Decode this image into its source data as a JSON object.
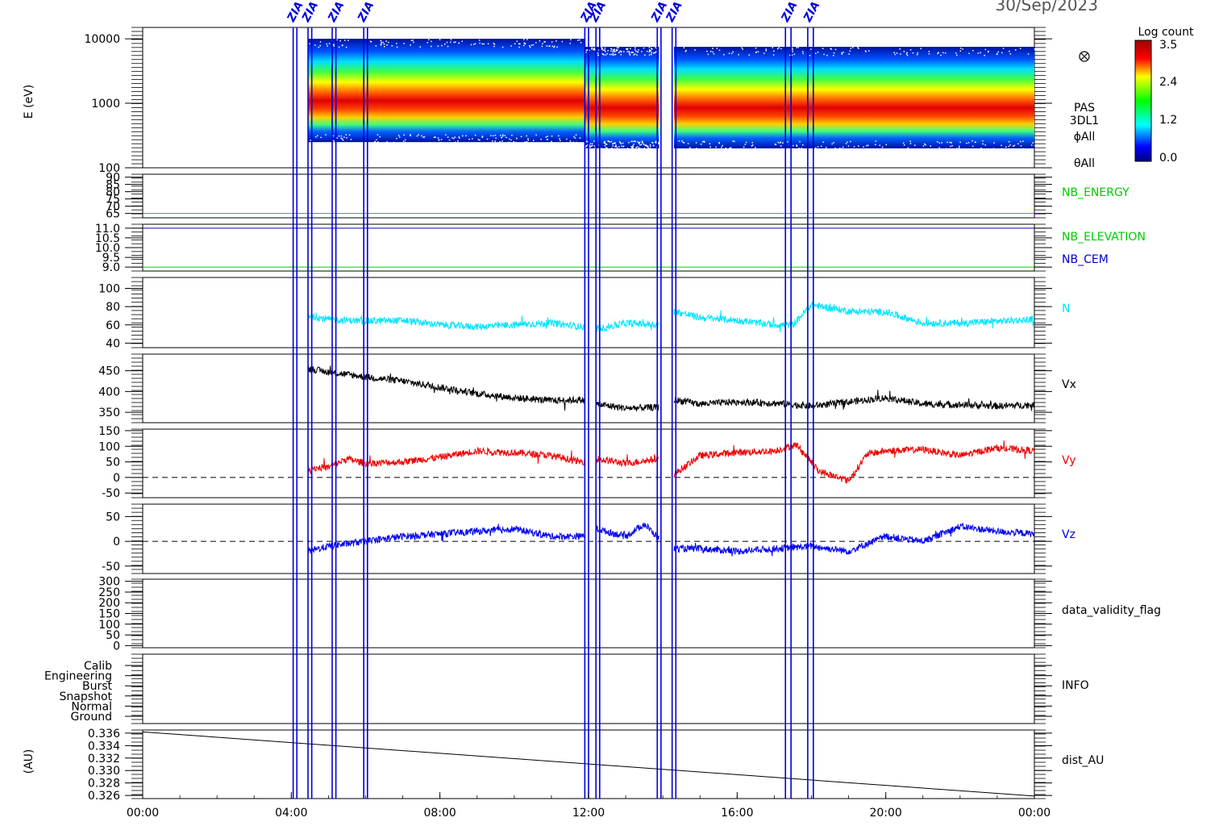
{
  "header": {
    "date": "30/Sep/2023"
  },
  "x_axis": {
    "ticks": [
      "00:00",
      "04:00",
      "08:00",
      "12:00",
      "16:00",
      "20:00",
      "00:00"
    ],
    "range_hours": [
      0,
      24
    ]
  },
  "marker_lines": {
    "color": "#0000dd",
    "hours": [
      4.05,
      4.15,
      4.45,
      4.55,
      5.1,
      5.2,
      5.95,
      6.05,
      11.9,
      12.0,
      12.2,
      12.3,
      13.85,
      13.95,
      14.25,
      14.35,
      17.3,
      17.45,
      17.9,
      18.05
    ],
    "tags": [
      {
        "hour": 4.1,
        "text": "ZIA"
      },
      {
        "hour": 4.5,
        "text": "ZIA"
      },
      {
        "hour": 5.2,
        "text": "ZIA"
      },
      {
        "hour": 6.0,
        "text": "ZIA"
      },
      {
        "hour": 12.0,
        "text": "ZIA"
      },
      {
        "hour": 12.25,
        "text": "ZIA"
      },
      {
        "hour": 13.9,
        "text": "ZIA"
      },
      {
        "hour": 14.3,
        "text": "ZIA"
      },
      {
        "hour": 17.4,
        "text": "ZIA"
      },
      {
        "hour": 18.0,
        "text": "ZIA"
      }
    ]
  },
  "colorbar": {
    "title": "Log count",
    "ticks": [
      "3.5",
      "2.4",
      "1.2",
      "0.0"
    ],
    "range": [
      0.0,
      3.5
    ]
  },
  "chart_data": [
    {
      "id": "spectrogram",
      "type": "heatmap",
      "ylabel": "E (eV)",
      "yscale": "log",
      "ylim": [
        100,
        15000
      ],
      "yticks": [
        "10000",
        "1000",
        "100"
      ],
      "right_labels": [
        "PAS",
        "3DL1",
        "ϕAll",
        "θAll"
      ],
      "data_intervals_hours": [
        [
          4.45,
          11.9,
          250,
          10000
        ],
        [
          11.9,
          13.9,
          200,
          7500
        ],
        [
          14.3,
          24,
          200,
          7500
        ]
      ],
      "peak_energy_eV": 850
    },
    {
      "id": "nb_energy",
      "type": "line",
      "label": "NB_ENERGY",
      "label_color": "#00cc00",
      "ylim": [
        62,
        92
      ],
      "yticks": [
        "90",
        "85",
        "80",
        "75",
        "70",
        "65"
      ],
      "series": [
        {
          "name": "NB_ENERGY",
          "color": "#00cc00",
          "constant": 65
        }
      ]
    },
    {
      "id": "nb_elevation",
      "type": "line",
      "labels": [
        {
          "text": "NB_ELEVATION",
          "color": "#00cc00"
        },
        {
          "text": "NB_CEM",
          "color": "#0000cc"
        }
      ],
      "ylim": [
        8.8,
        11.2
      ],
      "yticks": [
        "11.0",
        "10.5",
        "10.0",
        "9.5",
        "9.0"
      ],
      "series": [
        {
          "name": "NB_ELEVATION",
          "color": "#00cc00",
          "constant": 9.0
        },
        {
          "name": "NB_CEM",
          "color": "#0000cc",
          "constant": 11.0
        }
      ]
    },
    {
      "id": "density",
      "type": "line",
      "label": "N",
      "label_color": "#00e5ff",
      "ylim": [
        35,
        112
      ],
      "yticks": [
        "100",
        "80",
        "60",
        "40"
      ],
      "series": [
        {
          "name": "N",
          "color": "#00e5ff",
          "x": [
            4.45,
            5,
            6,
            7,
            8,
            9,
            10,
            11,
            11.8,
            12.2,
            13,
            13.9,
            14.3,
            15,
            16,
            17,
            17.5,
            18,
            19,
            20,
            21,
            22,
            23,
            24
          ],
          "y": [
            70,
            66,
            64,
            65,
            60,
            58,
            60,
            62,
            58,
            55,
            62,
            60,
            75,
            68,
            65,
            60,
            60,
            82,
            75,
            74,
            62,
            62,
            64,
            66
          ]
        }
      ]
    },
    {
      "id": "vx",
      "type": "line",
      "label": "Vx",
      "label_color": "#000000",
      "ylim": [
        325,
        490
      ],
      "yticks": [
        "450",
        "400",
        "350"
      ],
      "series": [
        {
          "name": "Vx",
          "color": "#000000",
          "x": [
            4.45,
            5,
            6,
            7,
            8,
            9,
            10,
            11,
            11.8,
            12.2,
            13,
            13.9,
            14.3,
            15,
            16,
            17,
            18,
            19,
            20,
            21,
            22,
            23,
            24
          ],
          "y": [
            455,
            447,
            435,
            425,
            410,
            395,
            385,
            378,
            380,
            370,
            360,
            362,
            380,
            370,
            375,
            372,
            365,
            375,
            385,
            370,
            368,
            365,
            368
          ]
        }
      ]
    },
    {
      "id": "vy",
      "type": "line",
      "label": "Vy",
      "label_color": "#ee0000",
      "ylim": [
        -65,
        155
      ],
      "yticks": [
        "150",
        "100",
        "50",
        "0",
        "-50"
      ],
      "zero_line": true,
      "series": [
        {
          "name": "Vy",
          "color": "#ee0000",
          "x": [
            4.45,
            5,
            5.5,
            6,
            7,
            8,
            9,
            10,
            11,
            11.8,
            12.2,
            13,
            13.9,
            14.3,
            15,
            16,
            17,
            17.6,
            18.2,
            19,
            19.5,
            20,
            21,
            22,
            23,
            24
          ],
          "y": [
            30,
            32,
            60,
            45,
            50,
            65,
            85,
            80,
            70,
            50,
            60,
            45,
            60,
            10,
            70,
            80,
            85,
            105,
            20,
            -10,
            75,
            85,
            90,
            70,
            95,
            85
          ]
        }
      ]
    },
    {
      "id": "vz",
      "type": "line",
      "label": "Vz",
      "label_color": "#0000ee",
      "ylim": [
        -65,
        75
      ],
      "yticks": [
        "50",
        "0",
        "-50"
      ],
      "zero_line": true,
      "series": [
        {
          "name": "Vz",
          "color": "#0000ee",
          "x": [
            4.45,
            5,
            6,
            7,
            8,
            9,
            10,
            11,
            11.8,
            12.2,
            13,
            13.5,
            13.9,
            14.3,
            15,
            16,
            17,
            18,
            19,
            20,
            21,
            22,
            23,
            24
          ],
          "y": [
            -20,
            -10,
            0,
            10,
            15,
            20,
            25,
            10,
            10,
            25,
            10,
            35,
            5,
            -15,
            -15,
            -20,
            -15,
            -10,
            -20,
            10,
            0,
            30,
            20,
            15
          ]
        }
      ]
    },
    {
      "id": "data_validity_flag",
      "type": "line",
      "label": "data_validity_flag",
      "label_color": "#000000",
      "ylim": [
        -10,
        310
      ],
      "yticks": [
        "300",
        "250",
        "200",
        "150",
        "100",
        "50",
        "0"
      ]
    },
    {
      "id": "info",
      "type": "line",
      "label": "INFO",
      "label_color": "#000000",
      "categories": [
        "Calib",
        "Engineering",
        "Burst",
        "Snapshot",
        "Normal",
        "Ground"
      ]
    },
    {
      "id": "dist_au",
      "type": "line",
      "label": "dist_AU",
      "label_color": "#000000",
      "ylabel": "(AU)",
      "ylim": [
        0.3255,
        0.3365
      ],
      "yticks": [
        "0.336",
        "0.334",
        "0.332",
        "0.330",
        "0.328",
        "0.326"
      ],
      "series": [
        {
          "name": "dist_AU",
          "color": "#000000",
          "x": [
            0,
            24
          ],
          "y": [
            0.3362,
            0.3259
          ]
        }
      ]
    }
  ]
}
